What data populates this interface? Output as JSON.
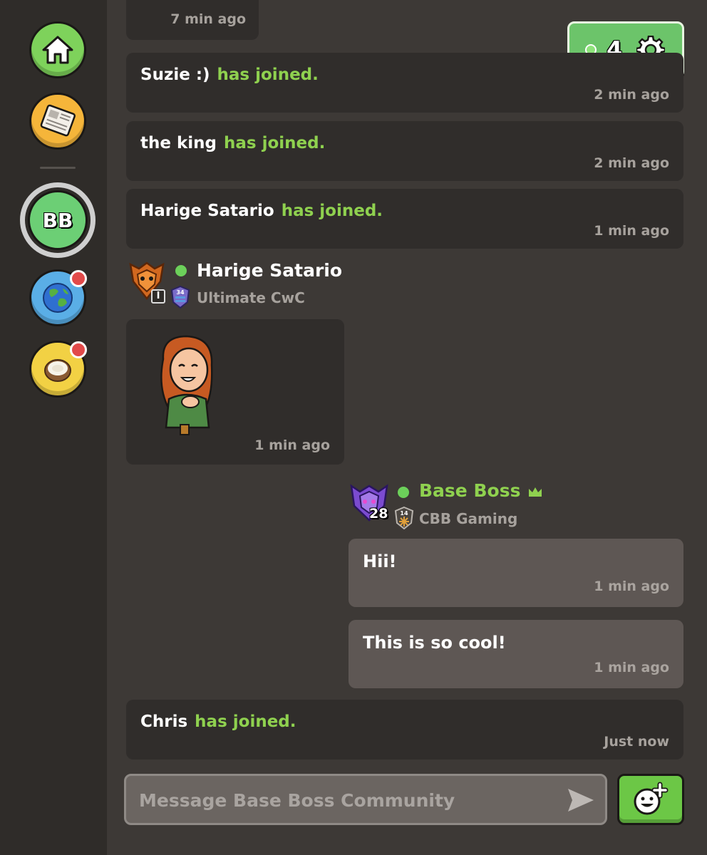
{
  "sidebar": {
    "home_label": "Home",
    "news_label": "News",
    "community_initials": "BB"
  },
  "online": {
    "count": "4"
  },
  "top_card": {
    "time": "7 min ago"
  },
  "events": [
    {
      "name": "Suzie :)",
      "action": "has joined.",
      "time": "2 min ago"
    },
    {
      "name": "the king",
      "action": "has joined.",
      "time": "2 min ago"
    },
    {
      "name": "Harige Satario",
      "action": "has joined.",
      "time": "1 min ago"
    }
  ],
  "message1": {
    "sender": "Harige Satario",
    "badge_level": "I",
    "clan_level": "34",
    "clan": "Ultimate CwC",
    "time": "1 min ago"
  },
  "message2": {
    "sender": "Base Boss",
    "level": "28",
    "clan_level": "14",
    "clan": "CBB Gaming",
    "bubbles": [
      {
        "text": "Hii!",
        "time": "1 min ago"
      },
      {
        "text": "This is so cool!",
        "time": "1 min ago"
      }
    ]
  },
  "event_last": {
    "name": "Chris",
    "action": "has joined.",
    "time": "Just now"
  },
  "composer": {
    "placeholder": "Message Base Boss Community"
  },
  "colors": {
    "accent_green": "#8fd14f",
    "background": "#3d3936",
    "card": "#302d2b",
    "own_bubble": "#5e5754",
    "online_widget": "#6cc46a"
  }
}
